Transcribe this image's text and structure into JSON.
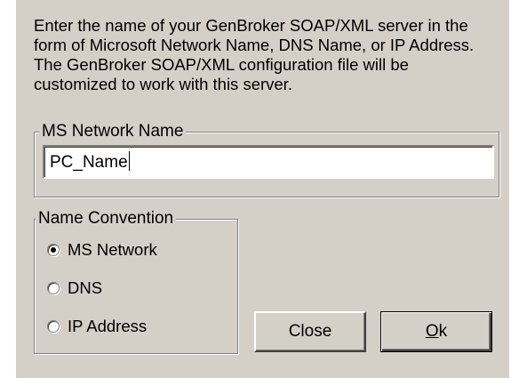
{
  "dialog": {
    "instructions": "Enter the name of your GenBroker SOAP/XML server in the form of Microsoft Network Name, DNS Name, or IP Address.  The GenBroker SOAP/XML configuration file will be customized to work with this server."
  },
  "server_group": {
    "legend": "MS Network Name",
    "server_name_value": "PC_Name"
  },
  "convention_group": {
    "legend": "Name Convention",
    "options": [
      {
        "label": "MS Network",
        "checked": true
      },
      {
        "label": "DNS",
        "checked": false
      },
      {
        "label": "IP Address",
        "checked": false
      }
    ]
  },
  "buttons": {
    "close_label": "Close",
    "ok_accel": "O",
    "ok_rest": "k"
  }
}
